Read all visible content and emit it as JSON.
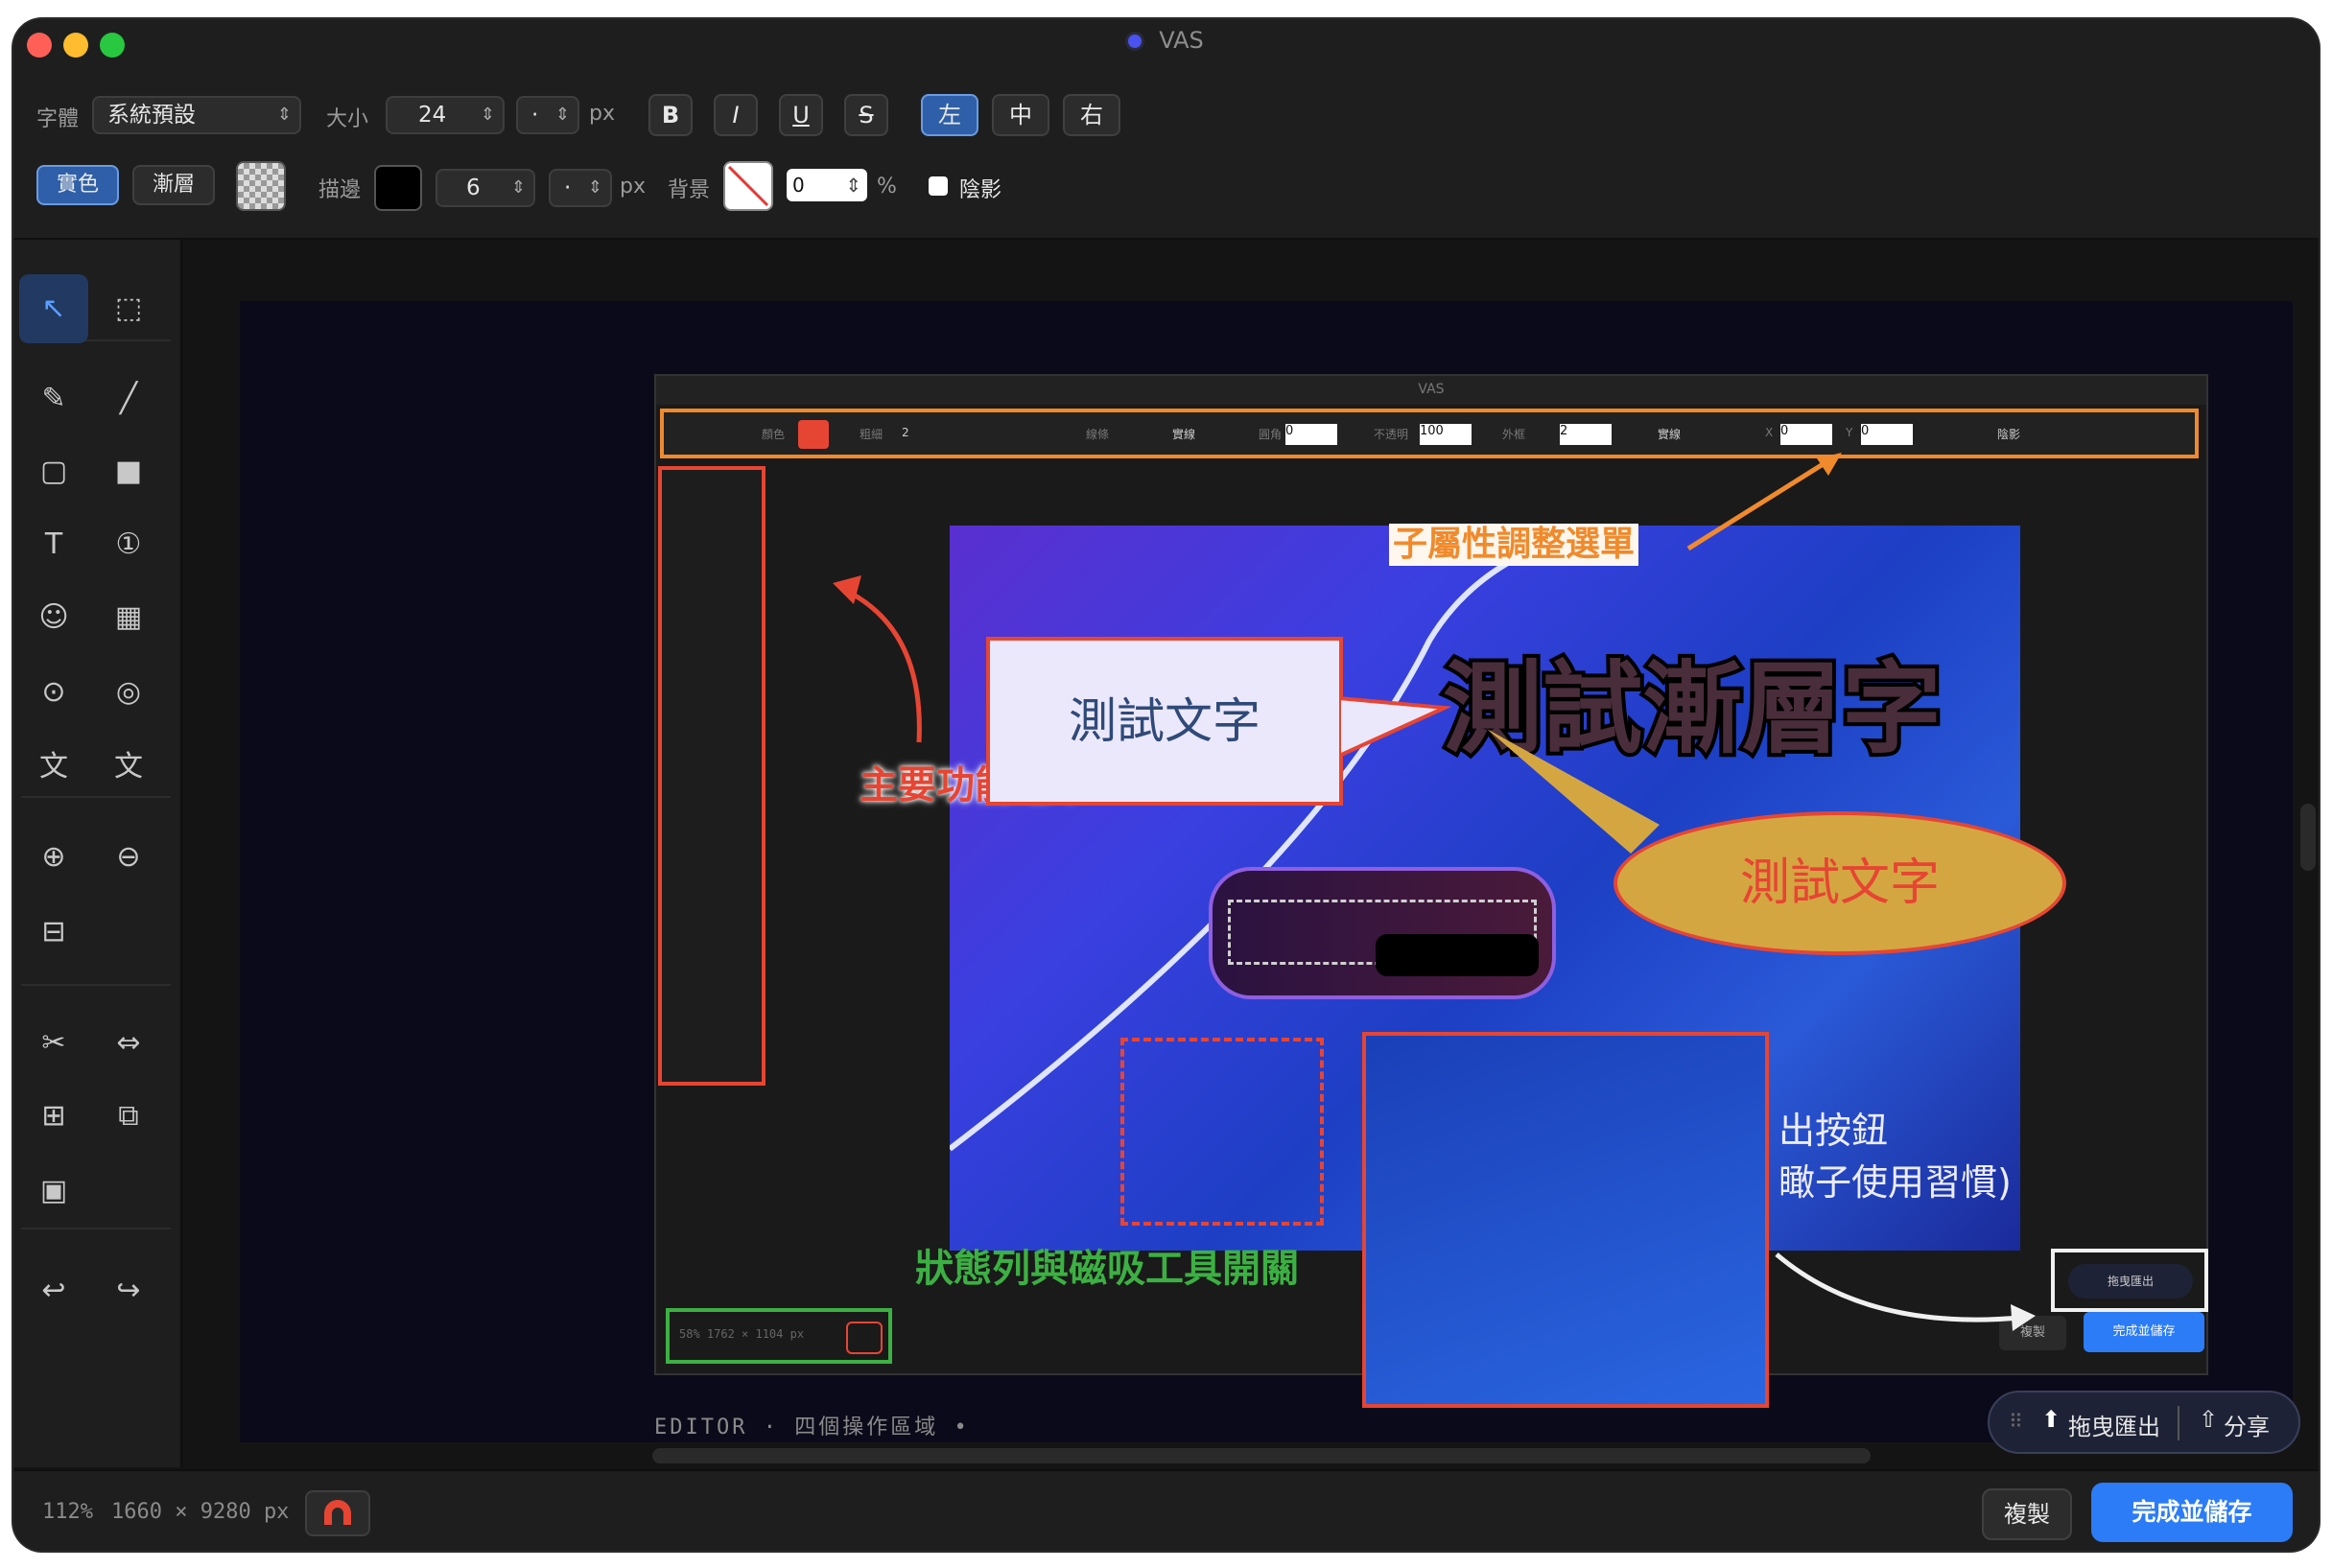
{
  "window": {
    "title": "VAS"
  },
  "toolbar": {
    "font_label": "字體",
    "font_value": "系統預設",
    "size_label": "大小",
    "size_value": "24",
    "size_unit_value": "·",
    "px": "px",
    "bold": "B",
    "italic": "I",
    "underline": "U",
    "strike": "S",
    "align_left": "左",
    "align_center": "中",
    "align_right": "右",
    "solid": "實色",
    "gradient": "漸層",
    "stroke_label": "描邊",
    "stroke_width": "6",
    "stroke_unit_value": "·",
    "bg_label": "背景",
    "bg_opacity": "0",
    "percent": "%",
    "shadow_label": "陰影"
  },
  "sidebar": {
    "tools": [
      {
        "icon": "arrow-pointer-icon",
        "glyph": "↖"
      },
      {
        "icon": "marquee-select-icon",
        "glyph": "⬚"
      },
      {
        "icon": "pen-icon",
        "glyph": "✎"
      },
      {
        "icon": "line-icon",
        "glyph": "╱"
      },
      {
        "icon": "rectangle-outline-icon",
        "glyph": "▢"
      },
      {
        "icon": "rectangle-filled-icon",
        "glyph": "■"
      },
      {
        "icon": "text-icon",
        "glyph": "T"
      },
      {
        "icon": "numbered-badge-icon",
        "glyph": "①"
      },
      {
        "icon": "emoji-icon",
        "glyph": "☺"
      },
      {
        "icon": "mosaic-icon",
        "glyph": "▦"
      },
      {
        "icon": "spotlight-icon",
        "glyph": "⊙"
      },
      {
        "icon": "magnifier-circle-icon",
        "glyph": "◎"
      },
      {
        "icon": "text-wen-icon",
        "glyph": "文"
      },
      {
        "icon": "text-wen-strike-icon",
        "glyph": "文"
      },
      {
        "icon": "zoom-in-icon",
        "glyph": "⊕"
      },
      {
        "icon": "zoom-out-icon",
        "glyph": "⊖"
      },
      {
        "icon": "fit-icon",
        "glyph": "⊟"
      },
      {
        "icon": "scissors-icon",
        "glyph": "✂"
      },
      {
        "icon": "resize-horizontal-icon",
        "glyph": "⇔"
      },
      {
        "icon": "grid-icon",
        "glyph": "⊞"
      },
      {
        "icon": "layers-icon",
        "glyph": "⧉"
      },
      {
        "icon": "frame-icon",
        "glyph": "▣"
      },
      {
        "icon": "undo-icon",
        "glyph": "↩"
      },
      {
        "icon": "redo-icon",
        "glyph": "↪"
      }
    ]
  },
  "canvas": {
    "editor_caption": "EDITOR · 四個操作區域 •",
    "annotations": {
      "sub_menu": "子屬性調整選單",
      "main_menu": "主要功能選單",
      "status_bar": "狀態列與磁吸工具開關",
      "test_text": "測試文字",
      "gradient_text": "測試漸層字",
      "ellipse_text": "測試文字",
      "export_line1": "出按鈕",
      "export_line2": "瞰子使用習慣)"
    },
    "floating": {
      "drag_export": "拖曳匯出",
      "share": "分享"
    },
    "inner_app": {
      "title": "VAS",
      "status_text": "58% 1762 × 1104 px",
      "copy": "複製",
      "save": "完成並儲存",
      "export": "拖曳匯出",
      "color_label": "顏色",
      "thickness_label": "粗細",
      "thickness_value": "2",
      "line_label": "線條",
      "line_style": "實線",
      "radius_label": "圓角",
      "radius_value": "0",
      "opacity_label": "不透明",
      "opacity_value": "100",
      "border_label": "外框",
      "border_value": "2",
      "x_label": "X",
      "x_value": "0",
      "y_label": "Y",
      "y_value": "0",
      "shadow_label": "陰影"
    }
  },
  "status": {
    "zoom": "112%",
    "dimensions": "1660 × 9280 px",
    "copy": "複製",
    "save": "完成並儲存"
  },
  "colors": {
    "accent": "#2b7cf6",
    "annotation_orange": "#f08a2c",
    "annotation_red": "#e74533",
    "annotation_green": "#3cb043"
  }
}
